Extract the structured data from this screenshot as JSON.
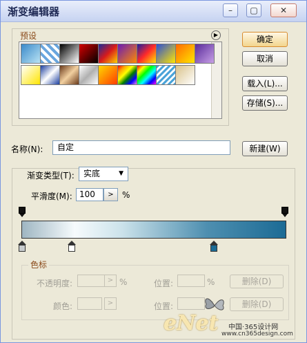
{
  "window": {
    "title": "渐变编辑器"
  },
  "titlebar": {
    "min_glyph": "–",
    "max_glyph": "▢",
    "close_glyph": "✕"
  },
  "presets": {
    "label": "预设",
    "menu_glyph": "▶",
    "swatches": [
      "linear-gradient(135deg,#3a89c9,#b9e3f4)",
      "repeating-linear-gradient(45deg,#6aa6de 0 4px,#ffffff 4px 8px)",
      "linear-gradient(135deg,#000000,#ffffff)",
      "linear-gradient(135deg,#d40000,#000000)",
      "linear-gradient(135deg,#1b2b9b,#d81b1b,#ffd200)",
      "linear-gradient(135deg,#6a1bb5,#ff8c00)",
      "linear-gradient(135deg,#1d1da0,#ff2a2a,#ffe800)",
      "linear-gradient(135deg,#2c4fd6,#ffe600)",
      "linear-gradient(135deg,#ff6a00,#ffe600)",
      "linear-gradient(135deg,#5a2a9a,#c7a0e6)",
      "linear-gradient(135deg,#ffffff,#ffe500)",
      "linear-gradient(135deg,#1c3f9f,#ffffff,#1c3f9f)",
      "linear-gradient(135deg,#6a3a1a,#f2d0a0,#6a3a1a)",
      "linear-gradient(135deg,#ffffff,#b0b0b0,#ffffff)",
      "linear-gradient(135deg,#ffd700,#ff3c00)",
      "linear-gradient(135deg,red,orange,yellow,green,blue,violet)",
      "linear-gradient(135deg,red,yellow,lime,cyan,blue,magenta)",
      "repeating-linear-gradient(135deg,#4aa3d8 0 3px,#ffffff 3px 6px)",
      "linear-gradient(135deg,#d9c28a,#ffffff)"
    ]
  },
  "buttons": {
    "ok": "确定",
    "cancel": "取消",
    "load": "载入(L)...",
    "save": "存储(S)...",
    "new": "新建(W)"
  },
  "name": {
    "label": "名称(N):",
    "value": "自定"
  },
  "gradient": {
    "type_label": "渐变类型(T):",
    "type_value": "实底",
    "smoothness_label": "平滑度(M):",
    "smoothness_value": "100",
    "stepper_glyph": ">",
    "percent": "%",
    "color_stops": [
      "#c8ccce",
      "#ffffff",
      "#1c6b95"
    ]
  },
  "stops": {
    "title": "色标",
    "opacity_label": "不透明度:",
    "color_label": "颜色:",
    "location_label": "位置:",
    "percent": "%",
    "delete_label": "删除(D)"
  },
  "watermark": {
    "logo": "eNet",
    "text": "中国·365设计网",
    "url": "www.cn365design.com"
  }
}
